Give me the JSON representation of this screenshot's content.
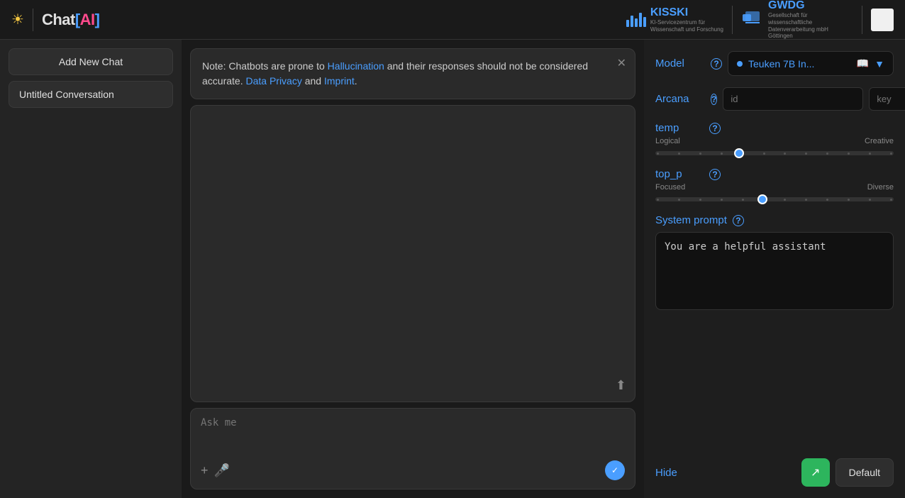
{
  "header": {
    "sun_icon": "☀",
    "logo_chat": "Chat",
    "logo_bracket_open": "[",
    "logo_ai": "AI",
    "logo_bracket_close": "]",
    "kisski_name": "KISSKI",
    "kisski_subtitle_line1": "KI-Servicezentrum für",
    "kisski_subtitle_line2": "Wissenschaft und Forschung",
    "gwdg_name": "GWDG",
    "gwdg_subtitle_line1": "Gesellschaft für wissenschaftliche",
    "gwdg_subtitle_line2": "Datenverarbeitung mbH Göttingen"
  },
  "sidebar": {
    "add_button_label": "Add New Chat",
    "conversations": [
      {
        "title": "Untitled Conversation"
      }
    ]
  },
  "notice": {
    "text_before_hallucination": "Note: Chatbots are prone to ",
    "hallucination_link": "Hallucination",
    "text_middle": " and their responses should not be considered accurate. ",
    "data_privacy_link": "Data Privacy",
    "text_and": " and ",
    "imprint_link": "Imprint",
    "text_end": "."
  },
  "chat": {
    "input_placeholder": "Ask me",
    "upload_icon": "⬆",
    "add_icon": "+",
    "mic_icon": "🎤",
    "send_icon": "✓"
  },
  "settings": {
    "model_label": "Model",
    "model_help": "?",
    "model_name": "Teuken 7B In...",
    "arcana_label": "Arcana",
    "arcana_help": "?",
    "arcana_id_placeholder": "id",
    "arcana_key_placeholder": "key",
    "temp_label": "temp",
    "temp_help": "?",
    "temp_left_label": "Logical",
    "temp_right_label": "Creative",
    "temp_value": 35,
    "top_p_label": "top_p",
    "top_p_help": "?",
    "top_p_left_label": "Focused",
    "top_p_right_label": "Diverse",
    "top_p_value": 45,
    "system_prompt_label": "System prompt",
    "system_prompt_help": "?",
    "system_prompt_value": "You are a helpful assistant",
    "hide_label": "Hide",
    "default_label": "Default",
    "share_icon": "↗"
  }
}
